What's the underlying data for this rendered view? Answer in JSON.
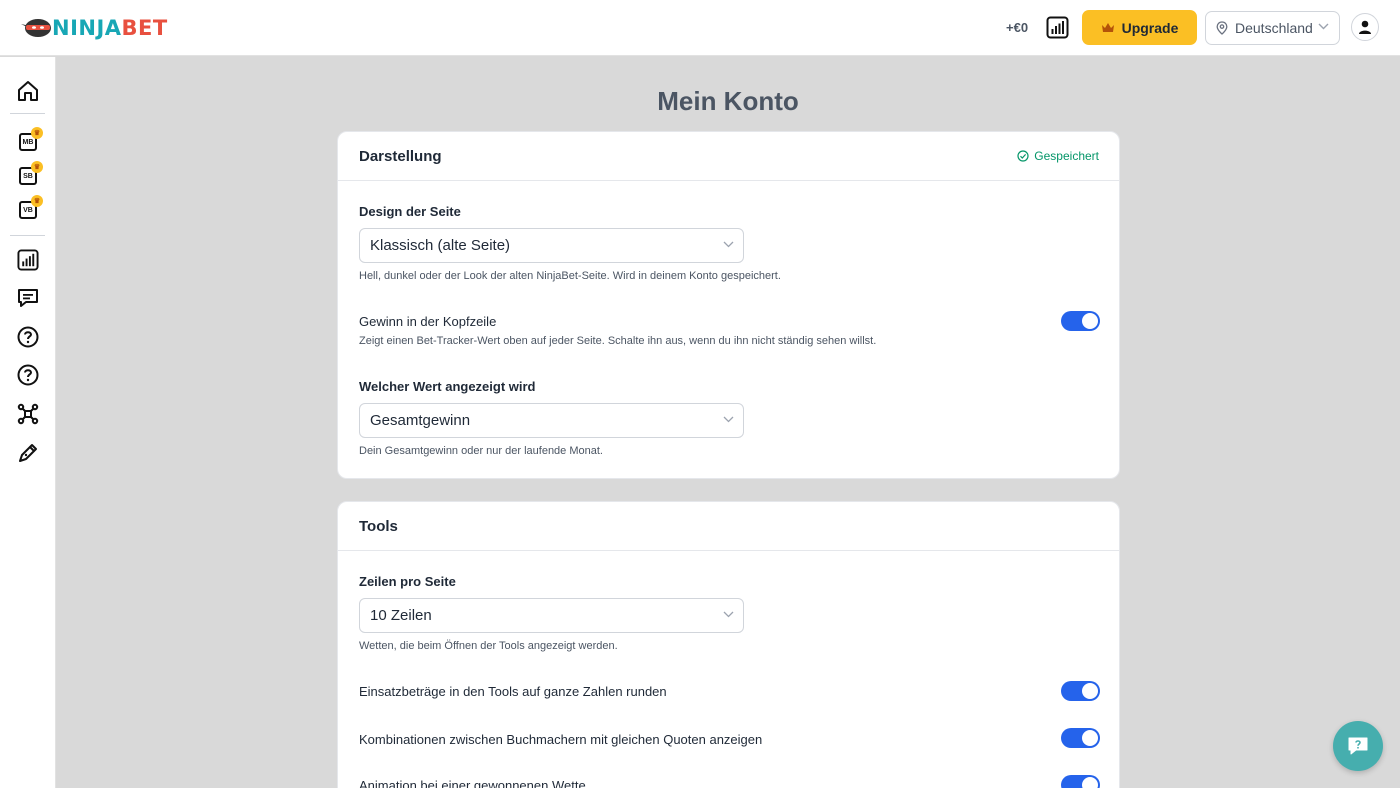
{
  "header": {
    "logo_part1": "NINJA",
    "logo_part2": "BET",
    "gain_value": "+€0",
    "upgrade_label": "Upgrade",
    "country_label": "Deutschland"
  },
  "sidebar": {
    "items": [
      {
        "icon": "home-icon"
      },
      {
        "icon": "matched-betting-icon",
        "badge": "MB",
        "premium": true
      },
      {
        "icon": "surebet-icon",
        "badge": "SB",
        "premium": true
      },
      {
        "icon": "valuebet-icon",
        "badge": "VB",
        "premium": true
      },
      {
        "icon": "bar-chart-icon"
      },
      {
        "icon": "chat-icon"
      },
      {
        "icon": "help-icon"
      },
      {
        "icon": "help-icon"
      },
      {
        "icon": "network-icon"
      },
      {
        "icon": "pen-icon"
      }
    ]
  },
  "page": {
    "title": "Mein Konto"
  },
  "darstellung": {
    "title": "Darstellung",
    "saved_label": "Gespeichert",
    "design_label": "Design der Seite",
    "design_value": "Klassisch (alte Seite)",
    "design_hint": "Hell, dunkel oder der Look der alten NinjaBet-Seite. Wird in deinem Konto gespeichert.",
    "gain_header_label": "Gewinn in der Kopfzeile",
    "gain_header_hint": "Zeigt einen Bet-Tracker-Wert oben auf jeder Seite. Schalte ihn aus, wenn du ihn nicht ständig sehen willst.",
    "gain_header_on": true,
    "value_label": "Welcher Wert angezeigt wird",
    "value_value": "Gesamtgewinn",
    "value_hint": "Dein Gesamtgewinn oder nur der laufende Monat."
  },
  "tools": {
    "title": "Tools",
    "rows_label": "Zeilen pro Seite",
    "rows_value": "10 Zeilen",
    "rows_hint": "Wetten, die beim Öffnen der Tools angezeigt werden.",
    "round_label": "Einsatzbeträge in den Tools auf ganze Zahlen runden",
    "round_on": true,
    "combos_label": "Kombinationen zwischen Buchmachern mit gleichen Quoten anzeigen",
    "combos_on": true,
    "animation_label": "Animation bei einer gewonnenen Wette",
    "animation_on": true
  },
  "colors": {
    "accent": "#2563eb",
    "upgrade": "#fbbf24",
    "saved": "#059669",
    "fab": "#46aeae"
  }
}
